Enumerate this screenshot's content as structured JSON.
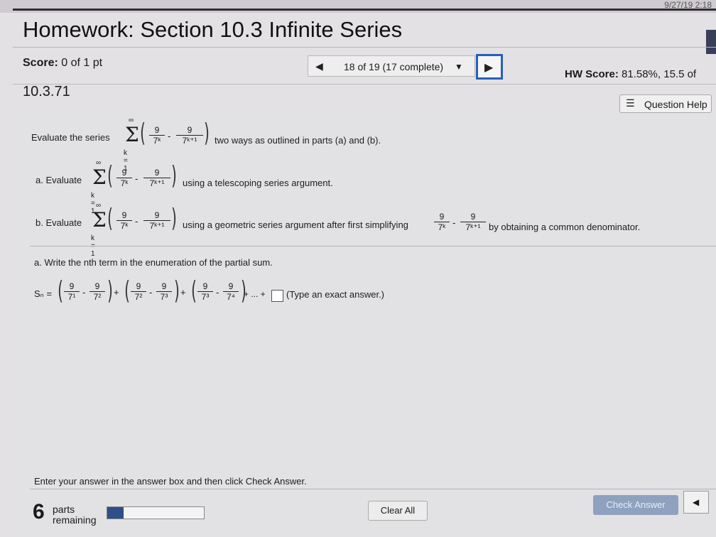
{
  "topbar": {
    "datetime": "9/27/19 2:18"
  },
  "title": "Homework: Section 10.3 Infinite Series",
  "score": {
    "label": "Score:",
    "value": "0 of 1 pt"
  },
  "nav": {
    "progress": "18 of 19 (17 complete)"
  },
  "hw_score": {
    "label": "HW Score:",
    "value": "81.58%, 15.5 of"
  },
  "question_number": "10.3.71",
  "question_help": "Question Help",
  "prompt": {
    "lead": "Evaluate the series",
    "tail": "two ways as outlined in parts (a) and (b).",
    "sum_top": "∞",
    "sum_bottom": "k = 1",
    "num": "9",
    "den1": "7ᵏ",
    "den2": "7ᵏ⁺¹"
  },
  "part_a": {
    "label": "a. Evaluate",
    "tail": "using a telescoping series argument."
  },
  "part_b": {
    "label": "b. Evaluate",
    "mid": "using a geometric series argument after first simplifying",
    "tail": "by obtaining a common denominator."
  },
  "sub_question": "a. Write the nth term in the enumeration of the partial sum.",
  "partial_sum": {
    "lhs": "Sₙ =",
    "terms": [
      {
        "d1": "7¹",
        "d2": "7²"
      },
      {
        "d1": "7²",
        "d2": "7³"
      },
      {
        "d1": "7³",
        "d2": "7⁴"
      }
    ],
    "ellipsis": "+ ... +",
    "hint": "(Type an exact answer.)"
  },
  "instruction": "Enter your answer in the answer box and then click Check Answer.",
  "parts": {
    "count": "6",
    "label1": "parts",
    "label2": "remaining",
    "progress_fraction": 0.17
  },
  "buttons": {
    "clear": "Clear All",
    "check": "Check Answer"
  }
}
